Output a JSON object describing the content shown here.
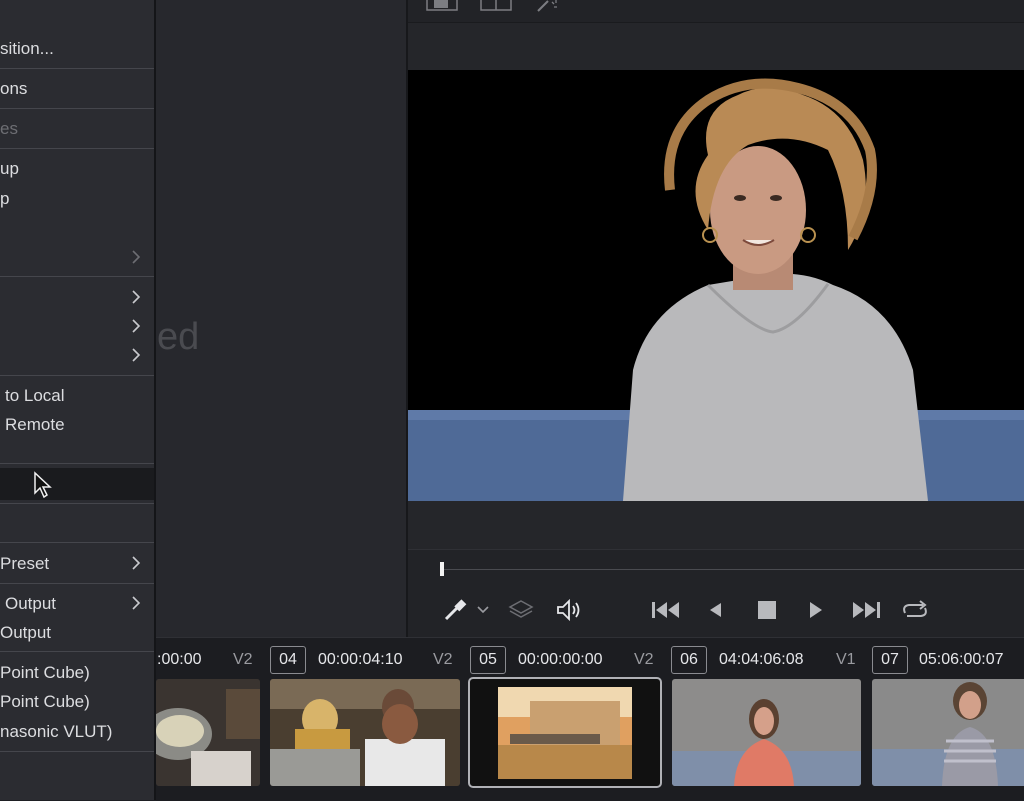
{
  "context_menu": {
    "items": [
      {
        "label": "sition...",
        "disabled": false,
        "submenu": false
      },
      {
        "label": "ons",
        "disabled": false,
        "submenu": false
      },
      {
        "label": "es",
        "disabled": true,
        "submenu": false
      },
      {
        "label": "up",
        "disabled": false,
        "submenu": false
      },
      {
        "label": "p",
        "disabled": false,
        "submenu": false
      },
      {
        "label": "",
        "disabled": false,
        "submenu": true
      },
      {
        "label": "",
        "disabled": false,
        "submenu": true
      },
      {
        "label": "",
        "disabled": false,
        "submenu": true
      },
      {
        "label": "",
        "disabled": false,
        "submenu": true
      },
      {
        "label": "to Local",
        "disabled": false,
        "submenu": false
      },
      {
        "label": "Remote",
        "disabled": false,
        "submenu": false
      },
      {
        "label": "",
        "disabled": false,
        "submenu": false,
        "highlighted": true
      },
      {
        "label": "Preset",
        "disabled": false,
        "submenu": true
      },
      {
        "label": "Output",
        "disabled": false,
        "submenu": true
      },
      {
        "label": "Output",
        "disabled": false,
        "submenu": false
      },
      {
        "label": "Point Cube)",
        "disabled": false,
        "submenu": false
      },
      {
        "label": "Point Cube)",
        "disabled": false,
        "submenu": false
      },
      {
        "label": "nasonic VLUT)",
        "disabled": false,
        "submenu": false
      }
    ]
  },
  "media_panel": {
    "ghost_text": "ed"
  },
  "viewer": {
    "toolbar_icons": [
      "single-viewer-icon",
      "dual-viewer-icon",
      "magic-wand-icon"
    ],
    "transport_icons": [
      "eyedropper-icon",
      "chevron-down-icon",
      "layers-icon",
      "volume-icon",
      "skip-back-icon",
      "step-back-icon",
      "stop-icon",
      "play-icon",
      "skip-forward-icon",
      "loop-icon"
    ]
  },
  "timeline": {
    "first_timecode": ":00:00",
    "clips": [
      {
        "track": "V2",
        "number": "04",
        "timecode": "00:00:04:10"
      },
      {
        "track": "V2",
        "number": "05",
        "timecode": "00:00:00:00"
      },
      {
        "track": "V2",
        "number": "06",
        "timecode": "04:04:06:08"
      },
      {
        "track": "V1",
        "number": "07",
        "timecode": "05:06:00:07"
      }
    ]
  },
  "colors": {
    "menu_bg": "#2b2c31",
    "panel_bg": "#27282d",
    "timeline_bg": "#1c1d21",
    "video_bg": "#000000"
  }
}
